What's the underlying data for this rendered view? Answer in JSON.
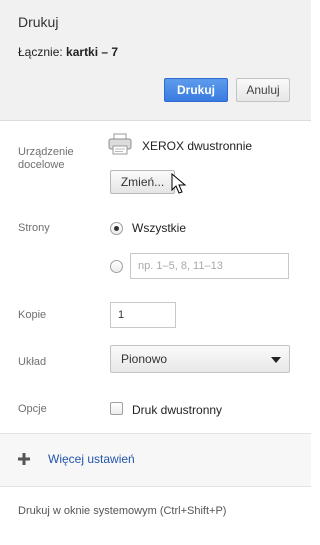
{
  "header": {
    "title": "Drukuj",
    "total_label": "Łącznie:",
    "total_value": "kartki – 7",
    "print_button": "Drukuj",
    "cancel_button": "Anuluj"
  },
  "destination": {
    "label_line1": "Urządzenie",
    "label_line2": "docelowe",
    "printer_name": "XEROX dwustronnie",
    "change_button": "Zmień..."
  },
  "pages": {
    "label": "Strony",
    "all_option": "Wszystkie",
    "all_selected": true,
    "custom_placeholder": "np. 1–5, 8, 11–13"
  },
  "copies": {
    "label": "Kopie",
    "value": "1"
  },
  "layout": {
    "label": "Układ",
    "selected": "Pionowo"
  },
  "options": {
    "label": "Opcje",
    "duplex_label": "Druk dwustronny",
    "duplex_checked": false
  },
  "more_settings": {
    "label": "Więcej ustawień",
    "icon": "plus-icon"
  },
  "system_dialog": {
    "label": "Drukuj w oknie systemowym (Ctrl+Shift+P)"
  },
  "colors": {
    "primary_button": "#3a7be0",
    "link": "#2255aa",
    "header_bg": "#f1f1f1"
  }
}
